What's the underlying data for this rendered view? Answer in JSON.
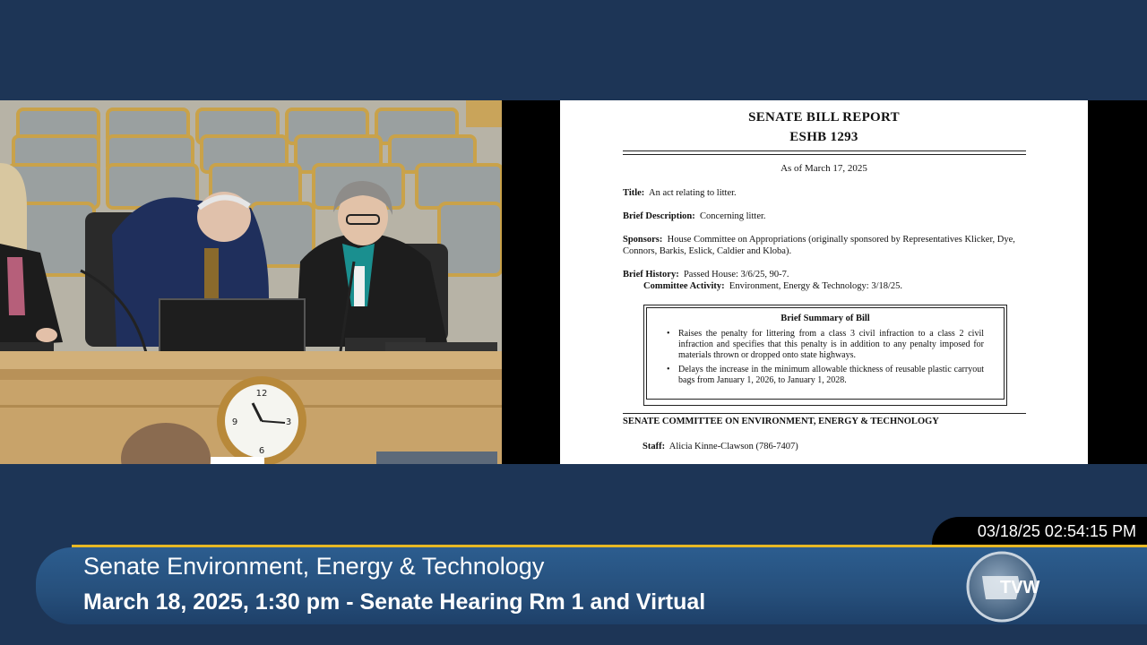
{
  "document": {
    "title_line1": "SENATE BILL REPORT",
    "title_line2": "ESHB 1293",
    "as_of": "As of March 17, 2025",
    "title_label": "Title:",
    "title_value": "An act relating to litter.",
    "brief_description_label": "Brief Description:",
    "brief_description_value": "Concerning litter.",
    "sponsors_label": "Sponsors:",
    "sponsors_value": "House Committee on Appropriations (originally sponsored by Representatives Klicker, Dye, Connors, Barkis, Eslick, Caldier and Kloba).",
    "brief_history_label": "Brief History:",
    "brief_history_value": "Passed House: 3/6/25, 90-7.",
    "committee_activity_label": "Committee Activity:",
    "committee_activity_value": "Environment, Energy & Technology: 3/18/25.",
    "summary_title": "Brief Summary of Bill",
    "summary_items": [
      "Raises the penalty for littering from a class 3 civil infraction to a class 2 civil infraction and specifies that this penalty is in addition to any penalty imposed for materials thrown or dropped onto state highways.",
      "Delays the increase in the minimum allowable thickness of reusable plastic carryout bags from January 1, 2026, to January 1, 2028."
    ],
    "committee_heading": "SENATE COMMITTEE ON ENVIRONMENT, ENERGY & TECHNOLOGY",
    "staff_label": "Staff:",
    "staff_value": "Alicia Kinne-Clawson (786-7407)"
  },
  "timestamp": "03/18/25 02:54:15 PM",
  "banner": {
    "line1": "Senate Environment, Energy & Technology",
    "line2": "March 18, 2025, 1:30 pm - Senate Hearing Rm 1 and Virtual"
  },
  "logo": {
    "text": "TVW",
    "icon": "washington-state-globe-icon"
  },
  "colors": {
    "background": "#1d3556",
    "banner": "#2c5d8f",
    "gold_line": "#e8b824"
  }
}
